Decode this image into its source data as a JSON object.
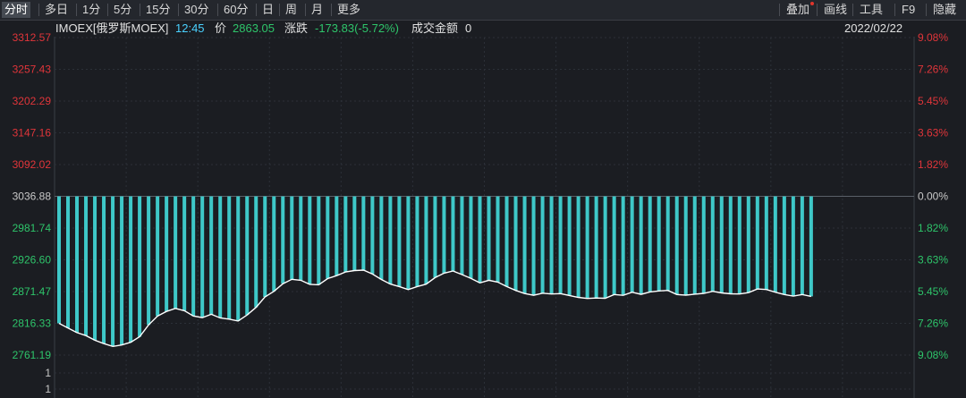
{
  "toolbar": {
    "left": [
      {
        "label": "分时",
        "active": true
      },
      {
        "label": "多日"
      },
      {
        "label": "1分"
      },
      {
        "label": "5分"
      },
      {
        "label": "15分"
      },
      {
        "label": "30分"
      },
      {
        "label": "60分"
      },
      {
        "label": "日"
      },
      {
        "label": "周"
      },
      {
        "label": "月"
      },
      {
        "label": "更多"
      }
    ],
    "right": [
      {
        "label": "叠加",
        "badge": true
      },
      {
        "label": "画线"
      },
      {
        "label": "工具"
      },
      {
        "label": "F9"
      },
      {
        "label": "隐藏"
      }
    ]
  },
  "info": {
    "symbol": "IMOEX[俄罗斯MOEX]",
    "time": "12:45",
    "price_label": "价",
    "price": "2863.05",
    "change_label": "涨跌",
    "change": "-173.83(-5.72%)",
    "amount_label": "成交金额",
    "amount": "0",
    "date": "2022/02/22"
  },
  "colors": {
    "up": "#c8101a",
    "down": "#3ec8c8",
    "price_line": "#ffffff",
    "grid": "#2c3038",
    "axis_up_text": "#e0353a",
    "axis_down_text": "#2ec46a",
    "axis_flat_text": "#c8c8c8"
  },
  "chart_data": {
    "type": "line",
    "base_price": 3036.88,
    "y_left_ticks": [
      "3312.57",
      "3257.43",
      "3202.29",
      "3147.16",
      "3092.02",
      "3036.88",
      "2981.74",
      "2926.60",
      "2871.47",
      "2816.33",
      "2761.19"
    ],
    "y_right_ticks": [
      "9.08%",
      "7.26%",
      "5.45%",
      "3.63%",
      "1.82%",
      "0.00%",
      "1.82%",
      "3.63%",
      "5.45%",
      "7.26%",
      "9.08%"
    ],
    "volume_axis_ticks": [
      "1",
      "1"
    ],
    "ylim": [
      2761.19,
      3312.57
    ],
    "slots": 96,
    "series": [
      {
        "values": [
          2816.3,
          2808.2,
          2800.1,
          2795.0,
          2786.9,
          2781.1,
          2776.2,
          2778.7,
          2783.4,
          2793.1,
          2813.6,
          2828.9,
          2837.0,
          2842.3,
          2838.2,
          2829.1,
          2826.2,
          2832.0,
          2825.6,
          2823.7,
          2820.3,
          2830.8,
          2844.0,
          2862.1,
          2872.0,
          2885.2,
          2892.7,
          2891.1,
          2884.0,
          2883.2,
          2894.0,
          2899.1,
          2905.5,
          2908.0,
          2908.7,
          2901.9,
          2892.5,
          2884.5,
          2880.2,
          2874.9,
          2880.2,
          2884.4,
          2895.7,
          2903.5,
          2907.2,
          2901.0,
          2894.4,
          2886.6,
          2891.1,
          2887.9,
          2880.2,
          2873.5,
          2868.1,
          2865.1,
          2868.6,
          2867.2,
          2867.9,
          2864.7,
          2861.4,
          2859.5,
          2860.3,
          2859.8,
          2866.3,
          2864.9,
          2870.4,
          2866.6,
          2870.9,
          2872.6,
          2873.5,
          2866.4,
          2865.3,
          2867.0,
          2868.3,
          2871.9,
          2869.1,
          2867.6,
          2867.2,
          2869.6,
          2875.9,
          2875.1,
          2870.4,
          2866.3,
          2863.6,
          2866.3,
          2863.1
        ]
      }
    ]
  }
}
